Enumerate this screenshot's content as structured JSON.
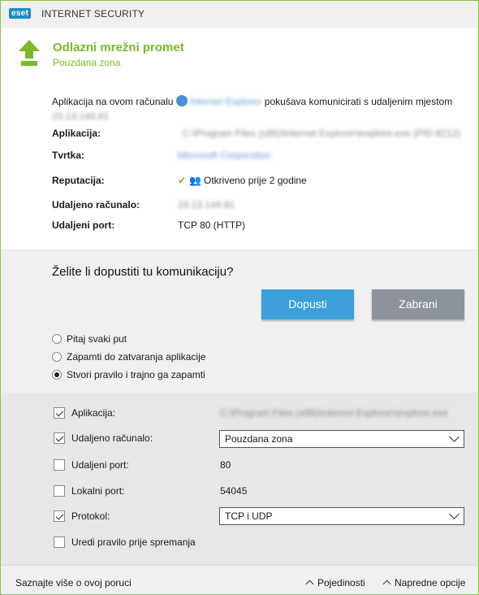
{
  "titlebar": {
    "logo": "eset",
    "product": "INTERNET SECURITY"
  },
  "header": {
    "title": "Odlazni mrežni promet",
    "subtitle": "Pouzdana zona",
    "icon": "arrow-up-icon",
    "accent": "#7ab929"
  },
  "info": {
    "desc_before": "Aplikacija na ovom računalu ",
    "app_name": "Internet Explorer",
    "desc_after": " pokušava komunicirati s udaljenim mjestom",
    "remote_addr": "23.13.144.81",
    "rows": {
      "app_label": "Aplikacija:",
      "app_value": "C:\\Program Files (x86)\\Internet Explorer\\iexplore.exe (PID 8212)",
      "company_label": "Tvrtka:",
      "company_value": "Microsoft Corporation",
      "reputation_label": "Reputacija:",
      "reputation_value": "Otkriveno prije 2 godine",
      "remote_label": "Udaljeno računalo:",
      "remote_value": "23.13.144.81",
      "port_label": "Udaljeni port:",
      "port_value": "TCP 80 (HTTP)"
    }
  },
  "question": {
    "text": "Želite li dopustiti tu komunikaciju?",
    "allow_label": "Dopusti",
    "deny_label": "Zabrani",
    "allow_color": "#3d9fd9",
    "deny_color": "#8d939a",
    "radios": [
      {
        "label": "Pitaj svaki put",
        "checked": false
      },
      {
        "label": "Zapamti do zatvaranja aplikacije",
        "checked": false
      },
      {
        "label": "Stvori pravilo i trajno ga zapamti",
        "checked": true
      }
    ]
  },
  "options": {
    "app": {
      "label": "Aplikacija:",
      "checked": true,
      "value": "C:\\Program Files (x86)\\Internet Explorer\\iexplore.exe"
    },
    "remote": {
      "label": "Udaljeno računalo:",
      "checked": true,
      "select": "Pouzdana zona"
    },
    "remote_port": {
      "label": "Udaljeni port:",
      "checked": false,
      "value": "80"
    },
    "local_port": {
      "label": "Lokalni port:",
      "checked": false,
      "value": "54045"
    },
    "protocol": {
      "label": "Protokol:",
      "checked": true,
      "select": "TCP i UDP"
    },
    "edit": {
      "label": "Uredi pravilo prije spremanja",
      "checked": false
    }
  },
  "footer": {
    "learn": "Saznajte više o ovoj poruci",
    "details": "Pojedinosti",
    "advanced": "Napredne opcije"
  }
}
